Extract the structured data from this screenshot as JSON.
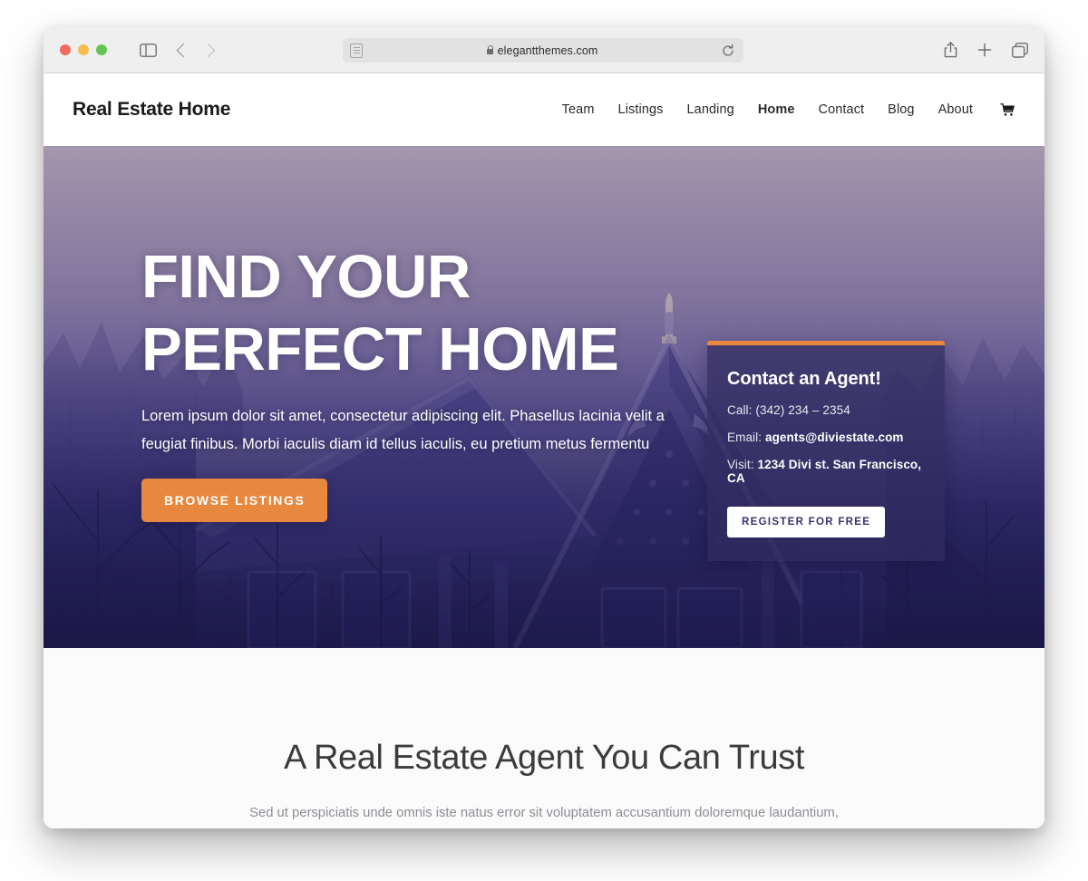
{
  "browser": {
    "url": "elegantthemes.com",
    "lock_icon": "lock-icon",
    "reader_icon": "reader-view-icon",
    "reload_icon": "reload-icon",
    "shield_icon": "privacy-shield-icon",
    "sidebar_icon": "sidebar-toggle-icon",
    "back_icon": "back-chevron-icon",
    "forward_icon": "forward-chevron-icon",
    "share_icon": "share-icon",
    "newtab_icon": "plus-icon",
    "tabs_icon": "tab-overview-icon"
  },
  "site": {
    "logo": "Real Estate Home",
    "nav": [
      {
        "label": "Team",
        "active": false
      },
      {
        "label": "Listings",
        "active": false
      },
      {
        "label": "Landing",
        "active": false
      },
      {
        "label": "Home",
        "active": true
      },
      {
        "label": "Contact",
        "active": false
      },
      {
        "label": "Blog",
        "active": false
      },
      {
        "label": "About",
        "active": false
      }
    ],
    "cart_icon": "shopping-cart-icon"
  },
  "hero": {
    "heading_line1": "FIND YOUR",
    "heading_line2": "PERFECT HOME",
    "subtitle": "Lorem ipsum dolor sit amet, consectetur adipiscing elit. Phasellus lacinia velit a feugiat finibus. Morbi iaculis diam id tellus iaculis, eu pretium metus fermentu",
    "cta_label": "BROWSE LISTINGS",
    "cta_color": "#e8883e"
  },
  "contact_card": {
    "title": "Contact an Agent!",
    "call_label": "Call:",
    "call_value": "(342) 234 – 2354",
    "email_label": "Email:",
    "email_value": "agents@diviestate.com",
    "visit_label": "Visit:",
    "visit_value": "1234 Divi st. San Francisco, CA",
    "button_label": "REGISTER FOR FREE",
    "accent_color": "#e8883e"
  },
  "trust": {
    "heading": "A Real Estate Agent You Can Trust",
    "paragraph": "Sed ut perspiciatis unde omnis iste natus error sit voluptatem accusantium doloremque laudantium, totam rem aperiam, eaque ipsa quae ab illo inventore veritatis et"
  }
}
